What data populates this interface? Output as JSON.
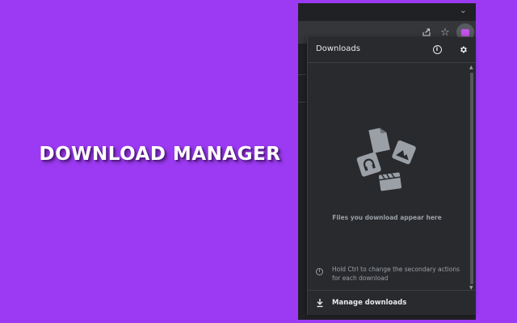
{
  "promo": {
    "title": "DOWNLOAD MANAGER"
  },
  "browser": {
    "icons": [
      "chevron-down-icon",
      "share-icon",
      "star-icon",
      "extension-icon"
    ]
  },
  "downloads_panel": {
    "title": "Downloads",
    "header_icons": [
      "info-icon",
      "gear-icon"
    ],
    "empty_state": {
      "message": "Files you download appear here"
    },
    "hint": {
      "text": "Hold Ctrl to change the secondary actions for each download"
    },
    "manage_label": "Manage downloads"
  },
  "colors": {
    "background": "#9b3af2",
    "panel": "#292a2d",
    "text_primary": "#e8eaed",
    "text_secondary": "#9aa0a6",
    "extension_accent": "#c353e6"
  }
}
